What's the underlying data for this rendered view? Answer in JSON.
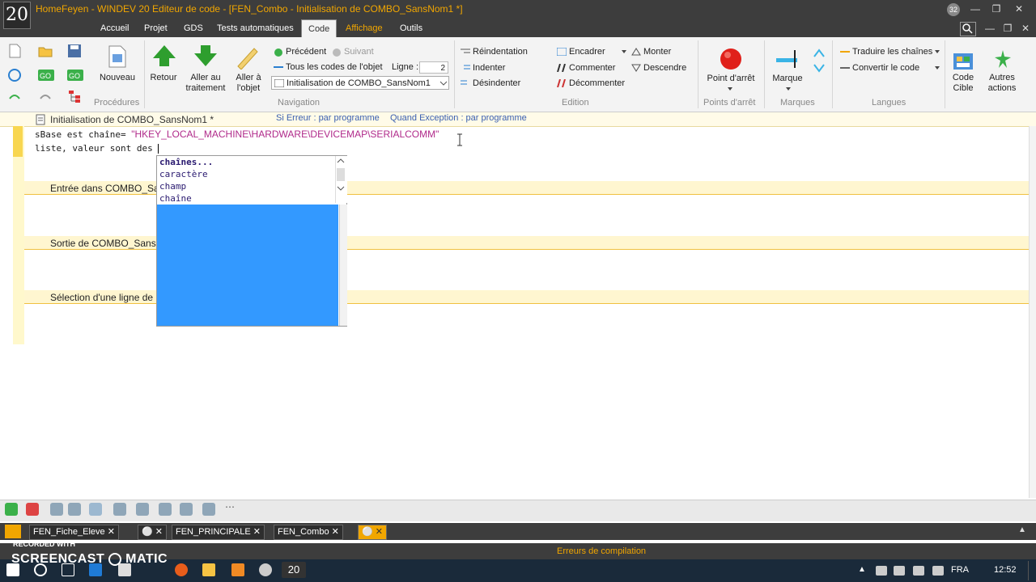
{
  "window": {
    "title": "HomeFeyen - WINDEV 20  Editeur de code - [FEN_Combo - Initialisation de COMBO_SansNom1 *]",
    "logo_text": "20",
    "notif_count": "32"
  },
  "ribbon_tabs": [
    "Accueil",
    "Projet",
    "GDS",
    "Tests automatiques",
    "Code",
    "Affichage",
    "Outils"
  ],
  "ribbon": {
    "nouveau": "Nouveau",
    "procedures": "Procédures",
    "retour": "Retour",
    "aller_traitement": [
      "Aller au",
      "traitement"
    ],
    "aller_objet": [
      "Aller à",
      "l'objet"
    ],
    "precedent": "Précédent",
    "suivant": "Suivant",
    "tous_codes": "Tous les codes de l'objet",
    "ligne_label": "Ligne :",
    "ligne_value": "2",
    "combo_value": "Initialisation de COMBO_SansNom1",
    "navigation": "Navigation",
    "reindentation": "Réindentation",
    "indenter": "Indenter",
    "desindenter": "Désindenter",
    "encadrer": "Encadrer",
    "commenter": "Commenter",
    "decommenter": "Décommenter",
    "monter": "Monter",
    "descendre": "Descendre",
    "edition": "Edition",
    "point_arret_btn": "Point d'arrêt",
    "points_arret": "Points d'arrêt",
    "marque_btn": "Marque",
    "marques": "Marques",
    "traduire": "Traduire les chaînes",
    "convertir": "Convertir le code",
    "langues": "Langues",
    "code_cible": [
      "Code",
      "Cible"
    ],
    "autres_actions": [
      "Autres",
      "actions"
    ]
  },
  "editor": {
    "proc_title": "Initialisation de COMBO_SansNom1 *",
    "si_erreur": "Si Erreur : par programme",
    "quand_exception": "Quand Exception : par programme",
    "line1_code": "sBase est chaîne= ",
    "line1_string": "\"HKEY_LOCAL_MACHINE\\HARDWARE\\DEVICEMAP\\SERIALCOMM\"",
    "line2_code": "liste, valeur sont des ",
    "sections": [
      "Entrée dans COMBO_Sa",
      "Sortie de COMBO_Sans",
      "Sélection d'une ligne de"
    ]
  },
  "autocomplete": {
    "items": [
      "chaînes...",
      "caractère",
      "champ",
      "chaîne"
    ]
  },
  "doc_tabs": [
    "FEN_Fiche_Eleve",
    "FEN_PRINCIPALE",
    "FEN_Combo"
  ],
  "status": {
    "compile_errors": "Erreurs de compilation"
  },
  "watermark": {
    "recorded": "RECORDED WITH",
    "brand": "SCREENCAST",
    "brand2": "MATIC"
  },
  "taskbar": {
    "lang": "FRA",
    "time": "12:52"
  },
  "colors": {
    "accent": "#f1a600",
    "chrome": "#3d3d3d",
    "selection": "#3399ff"
  }
}
